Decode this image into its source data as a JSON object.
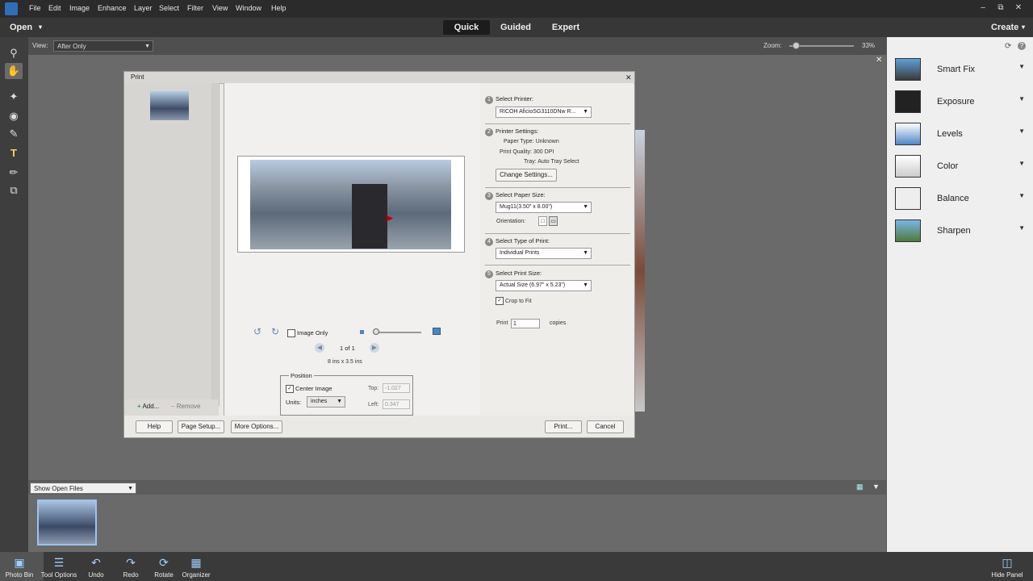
{
  "menubar": {
    "items": [
      "File",
      "Edit",
      "Image",
      "Enhance",
      "Layer",
      "Select",
      "Filter",
      "View",
      "Window",
      "Help"
    ],
    "window_controls": [
      "–",
      "⧉",
      "✕"
    ]
  },
  "modebar": {
    "open_label": "Open",
    "modes": [
      "Quick",
      "Guided",
      "Expert"
    ],
    "active_mode": "Quick",
    "create_label": "Create"
  },
  "optbar": {
    "view_label": "View:",
    "view_value": "After Only",
    "zoom_label": "Zoom:",
    "zoom_value": "33%",
    "zoom_level": 0.33
  },
  "tools": [
    "search-icon",
    "hand-icon",
    "quick-select-icon",
    "red-eye-icon",
    "whiten-teeth-icon",
    "text-icon",
    "spot-heal-icon",
    "crop-icon"
  ],
  "adjustments": [
    {
      "label": "Smart Fix"
    },
    {
      "label": "Exposure"
    },
    {
      "label": "Levels"
    },
    {
      "label": "Color"
    },
    {
      "label": "Balance"
    },
    {
      "label": "Sharpen"
    }
  ],
  "dialog": {
    "title": "Print",
    "close": "✕",
    "add_label": "Add...",
    "remove_label": "Remove",
    "image_only_label": "Image Only",
    "page_indicator": "1 of 1",
    "paper_dims": "8 ins x 3.5 ins",
    "position": {
      "legend": "Position",
      "center_label": "Center Image",
      "units_label": "Units:",
      "units_value": "inches",
      "top_label": "Top:",
      "top_value": "-1.027",
      "left_label": "Left:",
      "left_value": "0.347"
    },
    "steps": {
      "printer_label": "Select Printer:",
      "printer_value": "RICOH AficioSG3110DNw R...",
      "settings_label": "Printer Settings:",
      "paper_type": "Paper Type:  Unknown",
      "print_quality": "Print Quality:  300 DPI",
      "tray": "Tray:  Auto Tray Select",
      "change_settings": "Change Settings...",
      "paper_size_label": "Select Paper Size:",
      "paper_size_value": "Mug11(3.50\" x 8.00\")",
      "orientation_label": "Orientation:",
      "type_label": "Select Type of Print:",
      "type_value": "Individual Prints",
      "print_size_label": "Select Print Size:",
      "print_size_value": "Actual Size (6.97\" x 5.23\")",
      "crop_label": "Crop to Fit",
      "print_label": "Print",
      "copies_value": "1",
      "copies_label": "copies"
    },
    "buttons": {
      "help": "Help",
      "page_setup": "Page Setup...",
      "more_options": "More Options...",
      "print": "Print...",
      "cancel": "Cancel"
    }
  },
  "bin": {
    "show_label": "Show Open Files"
  },
  "taskbar": {
    "items": [
      "Photo Bin",
      "Tool Options",
      "Undo",
      "Redo",
      "Rotate",
      "Organizer"
    ],
    "hide_panel": "Hide Panel"
  }
}
